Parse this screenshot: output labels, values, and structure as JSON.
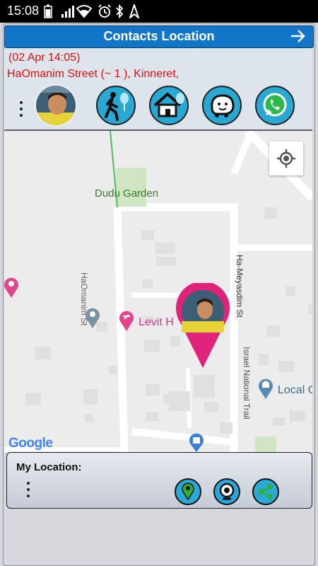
{
  "status_bar": {
    "time": "15:08",
    "icons": [
      "battery-icon",
      "signal-icon",
      "wifi-icon",
      "alarm-icon",
      "bluetooth-icon",
      "location-icon"
    ]
  },
  "header": {
    "title": "Contacts Location",
    "timestamp": "(02 Apr 14:05)",
    "address": "HaOmanim Street (~ 1 ), Kinneret,",
    "action_icons": [
      "walking-directions-icon",
      "home-icon",
      "waze-icon",
      "whatsapp-icon"
    ]
  },
  "map": {
    "labels": {
      "park": "Dudu Garden",
      "street_west": "HaOmanim St",
      "street_east": "Ha-Meyasdim St",
      "trail": "Israel National Trail",
      "place_pink": "Levit H",
      "place_local": "Local C"
    },
    "attribution": "Google"
  },
  "bottom": {
    "my_location_label": "My Location:",
    "buttons": [
      "map-pin-icon",
      "camera-icon",
      "share-icon"
    ]
  },
  "colors": {
    "title_bar": "#1176c8",
    "address_text": "#e01010",
    "marker": "#e0237a",
    "button_accent": "#2aa8d8"
  }
}
